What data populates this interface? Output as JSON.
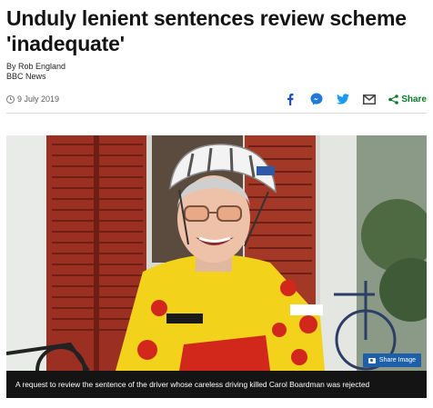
{
  "article": {
    "headline": "Unduly lenient sentences review scheme 'inadequate'",
    "byline": {
      "author": "By Rob England",
      "outlet": "BBC News"
    },
    "date": "9 July 2019",
    "share": {
      "icons": [
        "facebook-icon",
        "messenger-icon",
        "twitter-icon",
        "email-icon"
      ],
      "label": "Share"
    },
    "image": {
      "share_button_label": "Share Image",
      "caption": "A request to review the sentence of the driver whose careless driving killed Carol Boardman was rejected"
    }
  },
  "colors": {
    "headline": "#141414",
    "share_green": "#0b7a2a",
    "facebook_blue": "#1f4fb8",
    "messenger_blue": "#1e7ad6",
    "twitter_blue": "#1d9bf0",
    "caption_bg": "#141414",
    "share_image_bg": "#1d5fa8"
  }
}
